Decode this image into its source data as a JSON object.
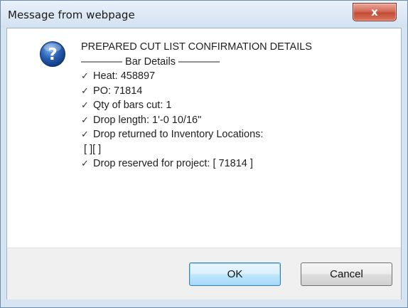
{
  "window": {
    "title": "Message from webpage",
    "close_glyph": "x"
  },
  "icon": "info-question-icon",
  "message": {
    "lines": [
      {
        "check": false,
        "text": "PREPARED CUT LIST CONFIRMATION DETAILS"
      },
      {
        "check": false,
        "text": "———— Bar Details ————"
      },
      {
        "check": true,
        "text": "Heat: 458897"
      },
      {
        "check": true,
        "text": "PO: 71814"
      },
      {
        "check": true,
        "text": "Qty of bars cut: 1"
      },
      {
        "check": true,
        "text": "Drop length: 1'-0 10/16\""
      },
      {
        "check": true,
        "text": "Drop returned to Inventory Locations:"
      },
      {
        "check": false,
        "text": " [ ][ ]"
      },
      {
        "check": true,
        "text": "Drop reserved for project: [ 71814 ]"
      }
    ],
    "check_glyph": "✓"
  },
  "buttons": {
    "ok": "OK",
    "cancel": "Cancel"
  },
  "colors": {
    "frame": "#d7e4f2",
    "close_red": "#c44c36",
    "icon_blue": "#1f4fa0",
    "default_button_border": "#3c7fb1"
  }
}
